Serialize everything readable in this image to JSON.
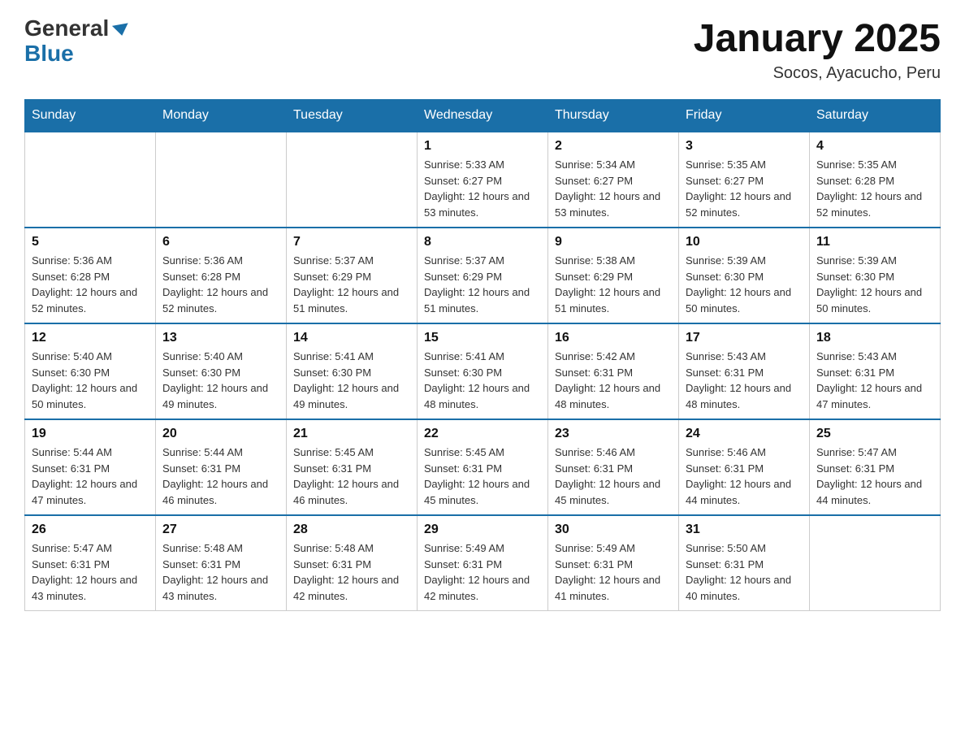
{
  "logo": {
    "general": "General",
    "blue": "Blue"
  },
  "title": "January 2025",
  "subtitle": "Socos, Ayacucho, Peru",
  "days_of_week": [
    "Sunday",
    "Monday",
    "Tuesday",
    "Wednesday",
    "Thursday",
    "Friday",
    "Saturday"
  ],
  "weeks": [
    [
      {
        "day": "",
        "info": ""
      },
      {
        "day": "",
        "info": ""
      },
      {
        "day": "",
        "info": ""
      },
      {
        "day": "1",
        "info": "Sunrise: 5:33 AM\nSunset: 6:27 PM\nDaylight: 12 hours and 53 minutes."
      },
      {
        "day": "2",
        "info": "Sunrise: 5:34 AM\nSunset: 6:27 PM\nDaylight: 12 hours and 53 minutes."
      },
      {
        "day": "3",
        "info": "Sunrise: 5:35 AM\nSunset: 6:27 PM\nDaylight: 12 hours and 52 minutes."
      },
      {
        "day": "4",
        "info": "Sunrise: 5:35 AM\nSunset: 6:28 PM\nDaylight: 12 hours and 52 minutes."
      }
    ],
    [
      {
        "day": "5",
        "info": "Sunrise: 5:36 AM\nSunset: 6:28 PM\nDaylight: 12 hours and 52 minutes."
      },
      {
        "day": "6",
        "info": "Sunrise: 5:36 AM\nSunset: 6:28 PM\nDaylight: 12 hours and 52 minutes."
      },
      {
        "day": "7",
        "info": "Sunrise: 5:37 AM\nSunset: 6:29 PM\nDaylight: 12 hours and 51 minutes."
      },
      {
        "day": "8",
        "info": "Sunrise: 5:37 AM\nSunset: 6:29 PM\nDaylight: 12 hours and 51 minutes."
      },
      {
        "day": "9",
        "info": "Sunrise: 5:38 AM\nSunset: 6:29 PM\nDaylight: 12 hours and 51 minutes."
      },
      {
        "day": "10",
        "info": "Sunrise: 5:39 AM\nSunset: 6:30 PM\nDaylight: 12 hours and 50 minutes."
      },
      {
        "day": "11",
        "info": "Sunrise: 5:39 AM\nSunset: 6:30 PM\nDaylight: 12 hours and 50 minutes."
      }
    ],
    [
      {
        "day": "12",
        "info": "Sunrise: 5:40 AM\nSunset: 6:30 PM\nDaylight: 12 hours and 50 minutes."
      },
      {
        "day": "13",
        "info": "Sunrise: 5:40 AM\nSunset: 6:30 PM\nDaylight: 12 hours and 49 minutes."
      },
      {
        "day": "14",
        "info": "Sunrise: 5:41 AM\nSunset: 6:30 PM\nDaylight: 12 hours and 49 minutes."
      },
      {
        "day": "15",
        "info": "Sunrise: 5:41 AM\nSunset: 6:30 PM\nDaylight: 12 hours and 48 minutes."
      },
      {
        "day": "16",
        "info": "Sunrise: 5:42 AM\nSunset: 6:31 PM\nDaylight: 12 hours and 48 minutes."
      },
      {
        "day": "17",
        "info": "Sunrise: 5:43 AM\nSunset: 6:31 PM\nDaylight: 12 hours and 48 minutes."
      },
      {
        "day": "18",
        "info": "Sunrise: 5:43 AM\nSunset: 6:31 PM\nDaylight: 12 hours and 47 minutes."
      }
    ],
    [
      {
        "day": "19",
        "info": "Sunrise: 5:44 AM\nSunset: 6:31 PM\nDaylight: 12 hours and 47 minutes."
      },
      {
        "day": "20",
        "info": "Sunrise: 5:44 AM\nSunset: 6:31 PM\nDaylight: 12 hours and 46 minutes."
      },
      {
        "day": "21",
        "info": "Sunrise: 5:45 AM\nSunset: 6:31 PM\nDaylight: 12 hours and 46 minutes."
      },
      {
        "day": "22",
        "info": "Sunrise: 5:45 AM\nSunset: 6:31 PM\nDaylight: 12 hours and 45 minutes."
      },
      {
        "day": "23",
        "info": "Sunrise: 5:46 AM\nSunset: 6:31 PM\nDaylight: 12 hours and 45 minutes."
      },
      {
        "day": "24",
        "info": "Sunrise: 5:46 AM\nSunset: 6:31 PM\nDaylight: 12 hours and 44 minutes."
      },
      {
        "day": "25",
        "info": "Sunrise: 5:47 AM\nSunset: 6:31 PM\nDaylight: 12 hours and 44 minutes."
      }
    ],
    [
      {
        "day": "26",
        "info": "Sunrise: 5:47 AM\nSunset: 6:31 PM\nDaylight: 12 hours and 43 minutes."
      },
      {
        "day": "27",
        "info": "Sunrise: 5:48 AM\nSunset: 6:31 PM\nDaylight: 12 hours and 43 minutes."
      },
      {
        "day": "28",
        "info": "Sunrise: 5:48 AM\nSunset: 6:31 PM\nDaylight: 12 hours and 42 minutes."
      },
      {
        "day": "29",
        "info": "Sunrise: 5:49 AM\nSunset: 6:31 PM\nDaylight: 12 hours and 42 minutes."
      },
      {
        "day": "30",
        "info": "Sunrise: 5:49 AM\nSunset: 6:31 PM\nDaylight: 12 hours and 41 minutes."
      },
      {
        "day": "31",
        "info": "Sunrise: 5:50 AM\nSunset: 6:31 PM\nDaylight: 12 hours and 40 minutes."
      },
      {
        "day": "",
        "info": ""
      }
    ]
  ]
}
